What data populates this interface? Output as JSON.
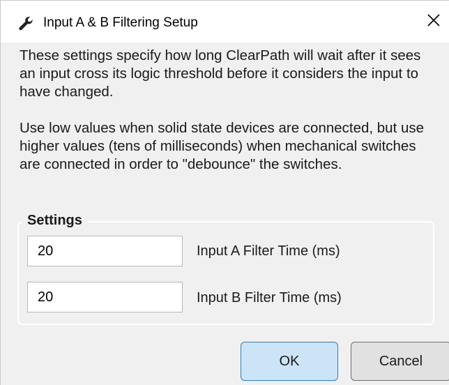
{
  "window": {
    "title": "Input A & B Filtering Setup",
    "title_icon": "wrench-icon",
    "close_icon": "close-icon"
  },
  "description": {
    "paragraph_1": "These settings specify how long ClearPath will wait after it sees an input cross its logic threshold before it considers the input to have changed.",
    "paragraph_2": "Use low values when solid state devices are connected, but use higher values (tens of milliseconds) when mechanical switches are connected in order to \"debounce\" the switches."
  },
  "settings": {
    "group_label": "Settings",
    "input_a": {
      "value": "20",
      "label": "Input A Filter Time (ms)"
    },
    "input_b": {
      "value": "20",
      "label": "Input B Filter Time (ms)"
    }
  },
  "buttons": {
    "ok_label": "OK",
    "cancel_label": "Cancel"
  },
  "colors": {
    "ok_button_fill": "#cce4f7",
    "ok_button_border": "#2f7fc2",
    "dialog_background": "#f0f0f0"
  }
}
